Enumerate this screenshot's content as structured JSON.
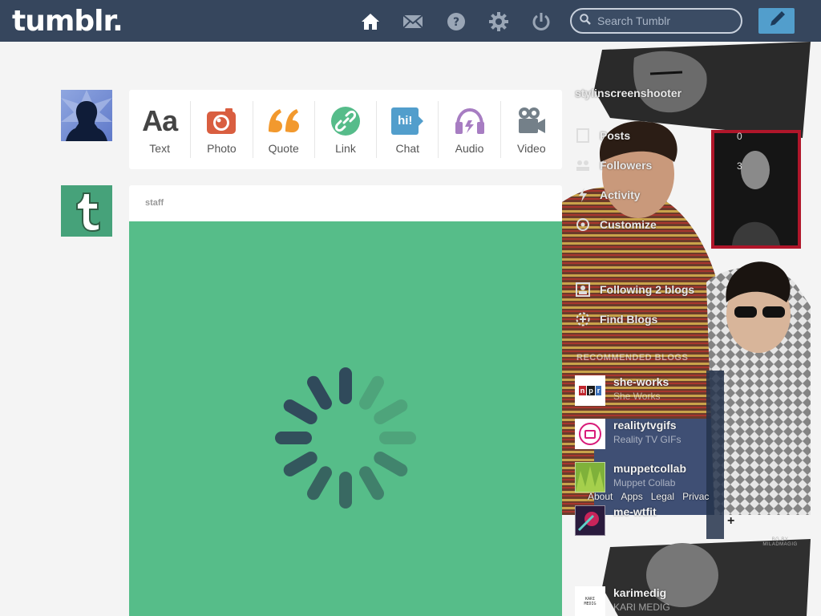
{
  "header": {
    "logo": "tumblr.",
    "search_placeholder": "Search Tumblr",
    "nav_icons": [
      "home-icon",
      "mail-icon",
      "help-icon",
      "gear-icon",
      "power-icon"
    ],
    "compose_icon": "pencil-icon"
  },
  "colors": {
    "header_bg": "#36465d",
    "compose_bg": "#529ecc",
    "post_media_bg": "#56bd89",
    "text_icon": "#444444",
    "photo_icon": "#d95e40",
    "quote_icon": "#f2992e",
    "link_icon": "#56bc8a",
    "chat_icon": "#529ecc",
    "audio_icon": "#a77dc2",
    "video_icon": "#748089"
  },
  "post_types": [
    {
      "label": "Text",
      "icon": "text-icon"
    },
    {
      "label": "Photo",
      "icon": "camera-icon"
    },
    {
      "label": "Quote",
      "icon": "quote-icon"
    },
    {
      "label": "Link",
      "icon": "link-icon"
    },
    {
      "label": "Chat",
      "icon": "chat-icon"
    },
    {
      "label": "Audio",
      "icon": "headphones-icon"
    },
    {
      "label": "Video",
      "icon": "video-camera-icon"
    }
  ],
  "text_icon_glyph": "Aa",
  "chat_icon_glyph": "hi!",
  "post": {
    "author": "staff"
  },
  "sidebar": {
    "blog_name": "stylinscreenshooter",
    "items": [
      {
        "label": "Posts",
        "count": "0",
        "icon": "posts-icon"
      },
      {
        "label": "Followers",
        "count": "3",
        "icon": "followers-icon"
      },
      {
        "label": "Activity",
        "icon": "activity-icon"
      },
      {
        "label": "Customize",
        "icon": "customize-icon"
      }
    ],
    "following": {
      "label": "Following 2 blogs",
      "icon": "following-icon"
    },
    "find_blogs": {
      "label": "Find Blogs",
      "icon": "find-blogs-icon"
    },
    "recommended_heading": "RECOMMENDED BLOGS",
    "recommended": [
      {
        "name": "she-works",
        "sub": "She Works",
        "badge": "npr"
      },
      {
        "name": "realitytvgifs",
        "sub": "Reality TV GIFs"
      },
      {
        "name": "muppetcollab",
        "sub": "Muppet Collab"
      },
      {
        "name": "me-wtfit",
        "sub": ""
      },
      {
        "name": "karimedig",
        "sub": "KARI MEDIG"
      }
    ],
    "footer_links": [
      "About",
      "Apps",
      "Legal",
      "Privac"
    ],
    "bg_credit": "BG BY MILADMAGIG"
  }
}
